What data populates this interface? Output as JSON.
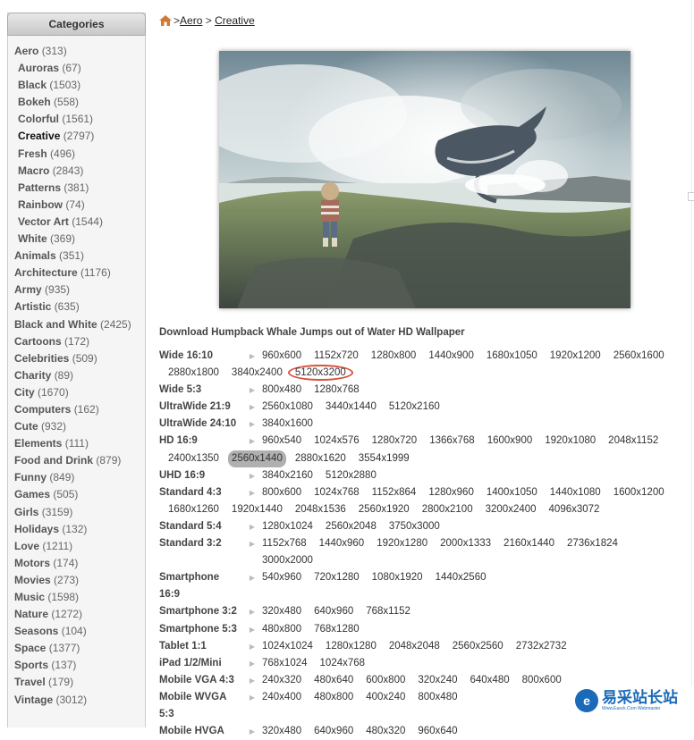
{
  "sidebar": {
    "header": "Categories",
    "items": [
      {
        "name": "Aero",
        "count": "(313)",
        "level": "top"
      },
      {
        "name": "Auroras",
        "count": "(67)",
        "level": "sub"
      },
      {
        "name": "Black",
        "count": "(1503)",
        "level": "sub"
      },
      {
        "name": "Bokeh",
        "count": "(558)",
        "level": "sub"
      },
      {
        "name": "Colorful",
        "count": "(1561)",
        "level": "sub"
      },
      {
        "name": "Creative",
        "count": "(2797)",
        "level": "sub",
        "active": true
      },
      {
        "name": "Fresh",
        "count": "(496)",
        "level": "sub"
      },
      {
        "name": "Macro",
        "count": "(2843)",
        "level": "sub"
      },
      {
        "name": "Patterns",
        "count": "(381)",
        "level": "sub"
      },
      {
        "name": "Rainbow",
        "count": "(74)",
        "level": "sub"
      },
      {
        "name": "Vector Art",
        "count": "(1544)",
        "level": "sub"
      },
      {
        "name": "White",
        "count": "(369)",
        "level": "sub"
      },
      {
        "name": "Animals",
        "count": "(351)",
        "level": "top"
      },
      {
        "name": "Architecture",
        "count": "(1176)",
        "level": "top"
      },
      {
        "name": "Army",
        "count": "(935)",
        "level": "top"
      },
      {
        "name": "Artistic",
        "count": "(635)",
        "level": "top"
      },
      {
        "name": "Black and White",
        "count": "(2425)",
        "level": "top"
      },
      {
        "name": "Cartoons",
        "count": "(172)",
        "level": "top"
      },
      {
        "name": "Celebrities",
        "count": "(509)",
        "level": "top"
      },
      {
        "name": "Charity",
        "count": "(89)",
        "level": "top"
      },
      {
        "name": "City",
        "count": "(1670)",
        "level": "top"
      },
      {
        "name": "Computers",
        "count": "(162)",
        "level": "top"
      },
      {
        "name": "Cute",
        "count": "(932)",
        "level": "top"
      },
      {
        "name": "Elements",
        "count": "(111)",
        "level": "top"
      },
      {
        "name": "Food and Drink",
        "count": "(879)",
        "level": "top"
      },
      {
        "name": "Funny",
        "count": "(849)",
        "level": "top"
      },
      {
        "name": "Games",
        "count": "(505)",
        "level": "top"
      },
      {
        "name": "Girls",
        "count": "(3159)",
        "level": "top"
      },
      {
        "name": "Holidays",
        "count": "(132)",
        "level": "top"
      },
      {
        "name": "Love",
        "count": "(1211)",
        "level": "top"
      },
      {
        "name": "Motors",
        "count": "(174)",
        "level": "top"
      },
      {
        "name": "Movies",
        "count": "(273)",
        "level": "top"
      },
      {
        "name": "Music",
        "count": "(1598)",
        "level": "top"
      },
      {
        "name": "Nature",
        "count": "(1272)",
        "level": "top"
      },
      {
        "name": "Seasons",
        "count": "(104)",
        "level": "top"
      },
      {
        "name": "Space",
        "count": "(1377)",
        "level": "top"
      },
      {
        "name": "Sports",
        "count": "(137)",
        "level": "top"
      },
      {
        "name": "Travel",
        "count": "(179)",
        "level": "top"
      },
      {
        "name": "Vintage",
        "count": "(3012)",
        "level": "top"
      }
    ]
  },
  "breadcrumb": {
    "sep1": "> ",
    "aero": "Aero",
    "sep2": " > ",
    "creative": "Creative"
  },
  "download": {
    "title": "Download Humpback Whale Jumps out of Water HD Wallpaper",
    "rows": [
      {
        "label": "Wide 16:10",
        "res": [
          "960x600",
          "1152x720",
          "1280x800",
          "1440x900",
          "1680x1050",
          "1920x1200",
          "2560x1600"
        ]
      },
      {
        "label": "",
        "cont": true,
        "res": [
          "2880x1800",
          "3840x2400",
          "5120x3200"
        ],
        "circled": "5120x3200"
      },
      {
        "label": "Wide 5:3",
        "res": [
          "800x480",
          "1280x768"
        ]
      },
      {
        "label": "UltraWide 21:9",
        "res": [
          "2560x1080",
          "3440x1440",
          "5120x2160"
        ]
      },
      {
        "label": "UltraWide 24:10",
        "res": [
          "3840x1600"
        ]
      },
      {
        "label": "HD 16:9",
        "res": [
          "960x540",
          "1024x576",
          "1280x720",
          "1366x768",
          "1600x900",
          "1920x1080",
          "2048x1152"
        ]
      },
      {
        "label": "",
        "cont": true,
        "res": [
          "2400x1350",
          "2560x1440",
          "2880x1620",
          "3554x1999"
        ],
        "highlight": "2560x1440"
      },
      {
        "label": "UHD 16:9",
        "res": [
          "3840x2160",
          "5120x2880"
        ]
      },
      {
        "label": "Standard 4:3",
        "res": [
          "800x600",
          "1024x768",
          "1152x864",
          "1280x960",
          "1400x1050",
          "1440x1080",
          "1600x1200"
        ]
      },
      {
        "label": "",
        "cont": true,
        "res": [
          "1680x1260",
          "1920x1440",
          "2048x1536",
          "2560x1920",
          "2800x2100",
          "3200x2400",
          "4096x3072"
        ]
      },
      {
        "label": "Standard 5:4",
        "res": [
          "1280x1024",
          "2560x2048",
          "3750x3000"
        ]
      },
      {
        "label": "Standard 3:2",
        "res": [
          "1152x768",
          "1440x960",
          "1920x1280",
          "2000x1333",
          "2160x1440",
          "2736x1824",
          "3000x2000"
        ]
      },
      {
        "label": "Smartphone",
        "res": [
          "540x960",
          "720x1280",
          "1080x1920",
          "1440x2560"
        ]
      },
      {
        "label": "16:9",
        "noarrow": true,
        "res": []
      },
      {
        "label": "Smartphone 3:2",
        "res": [
          "320x480",
          "640x960",
          "768x1152"
        ]
      },
      {
        "label": "Smartphone 5:3",
        "res": [
          "480x800",
          "768x1280"
        ]
      },
      {
        "label": "Tablet 1:1",
        "res": [
          "1024x1024",
          "1280x1280",
          "2048x2048",
          "2560x2560",
          "2732x2732"
        ]
      },
      {
        "label": "iPad 1/2/Mini",
        "res": [
          "768x1024",
          "1024x768"
        ]
      },
      {
        "label": "Mobile VGA 4:3",
        "res": [
          "240x320",
          "480x640",
          "600x800",
          "320x240",
          "640x480",
          "800x600"
        ]
      },
      {
        "label": "Mobile WVGA",
        "res": [
          "240x400",
          "480x800",
          "400x240",
          "800x480"
        ]
      },
      {
        "label": "5:3",
        "noarrow": true,
        "res": []
      },
      {
        "label": "Mobile HVGA",
        "res": [
          "320x480",
          "640x960",
          "480x320",
          "960x640"
        ]
      }
    ]
  },
  "watermark": {
    "text": "易采站长站",
    "sub": "Www.Easck.Com Webmaster"
  },
  "colors": {
    "circle": "#d9513c",
    "highlight": "#b0b0b0",
    "watermark": "#1a6ab8"
  },
  "icons": {
    "home": "home-icon"
  }
}
